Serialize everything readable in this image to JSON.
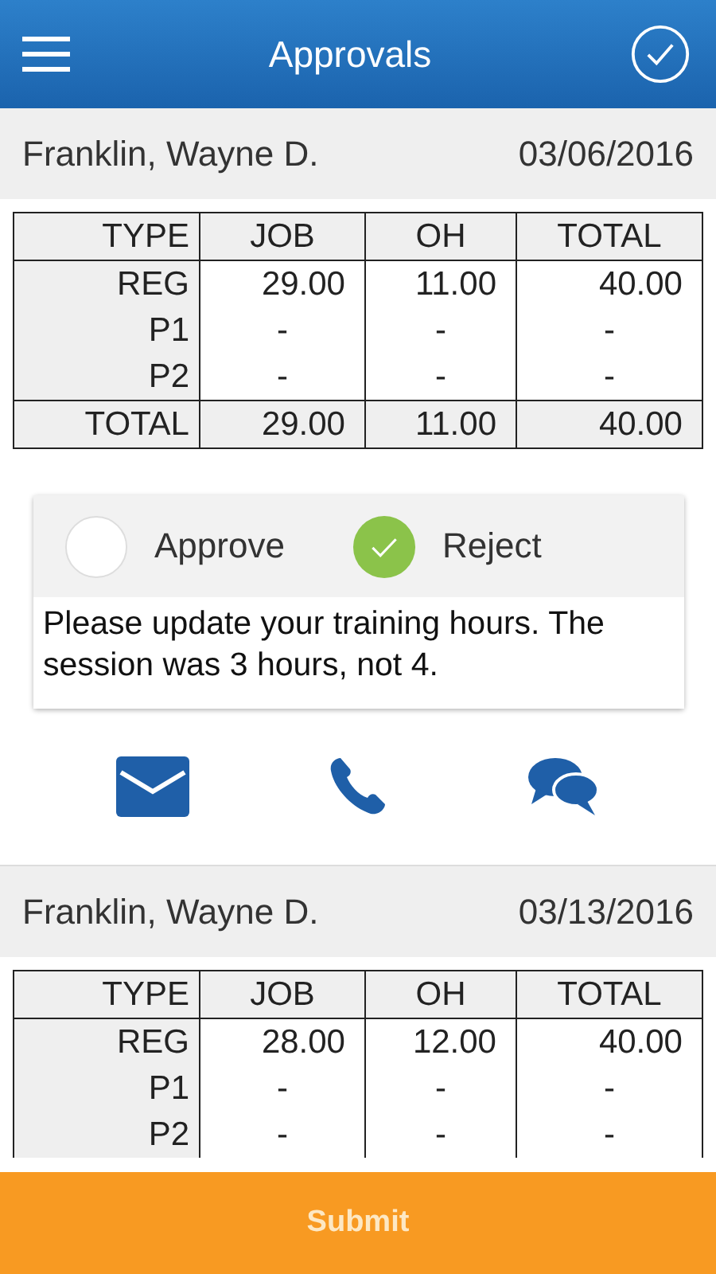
{
  "header": {
    "title": "Approvals"
  },
  "entries": [
    {
      "name": "Franklin, Wayne D.",
      "date": "03/06/2016",
      "table": {
        "columns": [
          "TYPE",
          "JOB",
          "OH",
          "TOTAL"
        ],
        "rows": [
          [
            "REG",
            "29.00",
            "11.00",
            "40.00"
          ],
          [
            "P1",
            "-",
            "-",
            "-"
          ],
          [
            "P2",
            "-",
            "-",
            "-"
          ]
        ],
        "total": [
          "TOTAL",
          "29.00",
          "11.00",
          "40.00"
        ]
      },
      "decision": {
        "options": [
          {
            "label": "Approve",
            "selected": false
          },
          {
            "label": "Reject",
            "selected": true
          }
        ],
        "comment": "Please update your training hours. The session was 3 hours, not 4."
      },
      "contacts": [
        {
          "kind": "mail"
        },
        {
          "kind": "phone"
        },
        {
          "kind": "chat"
        }
      ]
    },
    {
      "name": "Franklin, Wayne D.",
      "date": "03/13/2016",
      "table": {
        "columns": [
          "TYPE",
          "JOB",
          "OH",
          "TOTAL"
        ],
        "rows": [
          [
            "REG",
            "28.00",
            "12.00",
            "40.00"
          ],
          [
            "P1",
            "-",
            "-",
            "-"
          ],
          [
            "P2",
            "-",
            "-",
            "-"
          ]
        ]
      }
    }
  ],
  "submit": "Submit"
}
